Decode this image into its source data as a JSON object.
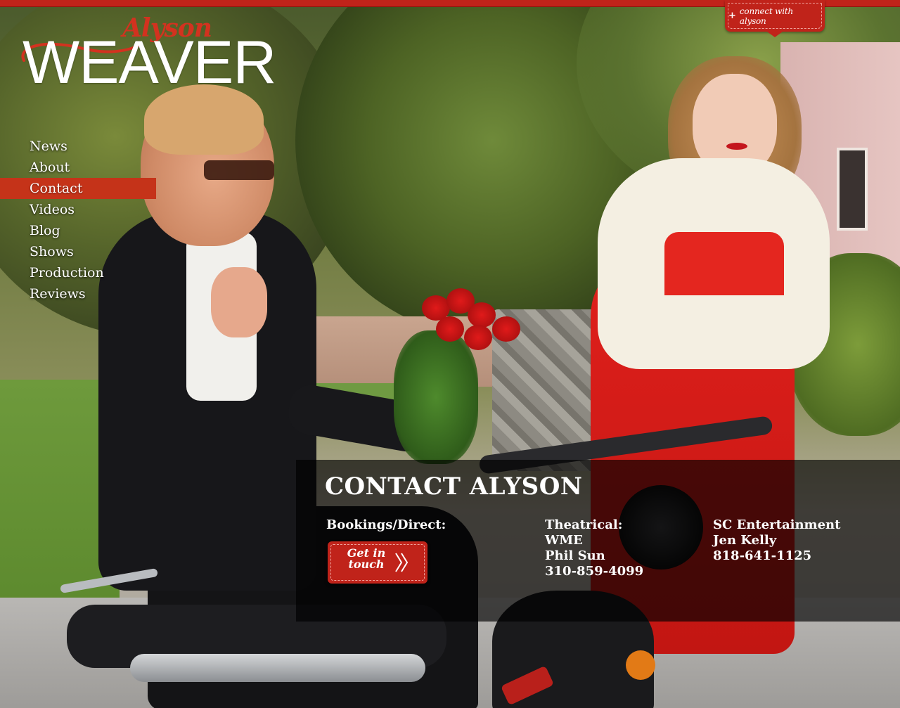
{
  "header": {
    "connect_plus": "+",
    "connect_label": "connect with alyson"
  },
  "logo": {
    "script_text": "Alyson",
    "main_text": "WEAVER"
  },
  "nav": {
    "items": [
      {
        "label": "News"
      },
      {
        "label": "About"
      },
      {
        "label": "Contact"
      },
      {
        "label": "Videos"
      },
      {
        "label": "Blog"
      },
      {
        "label": "Shows"
      },
      {
        "label": "Production"
      },
      {
        "label": "Reviews"
      }
    ],
    "active": "Contact"
  },
  "contact": {
    "title": "CONTACT ALYSON",
    "bookings": {
      "heading": "Bookings/Direct:",
      "button_label_line1": "Get in",
      "button_label_line2": "touch",
      "button_icon": "double-chevron-right-icon"
    },
    "theatrical": {
      "heading": "Theatrical:",
      "agency": "WME",
      "agent": "Phil Sun",
      "phone": "310-859-4099"
    },
    "commercial": {
      "agency": "SC Entertainment",
      "agent": "Jen Kelly",
      "phone": "818-641-1125"
    }
  },
  "colors": {
    "brand_red": "#c0231a",
    "nav_active": "#c53319",
    "panel_overlay": "rgba(0,0,0,0.66)"
  }
}
